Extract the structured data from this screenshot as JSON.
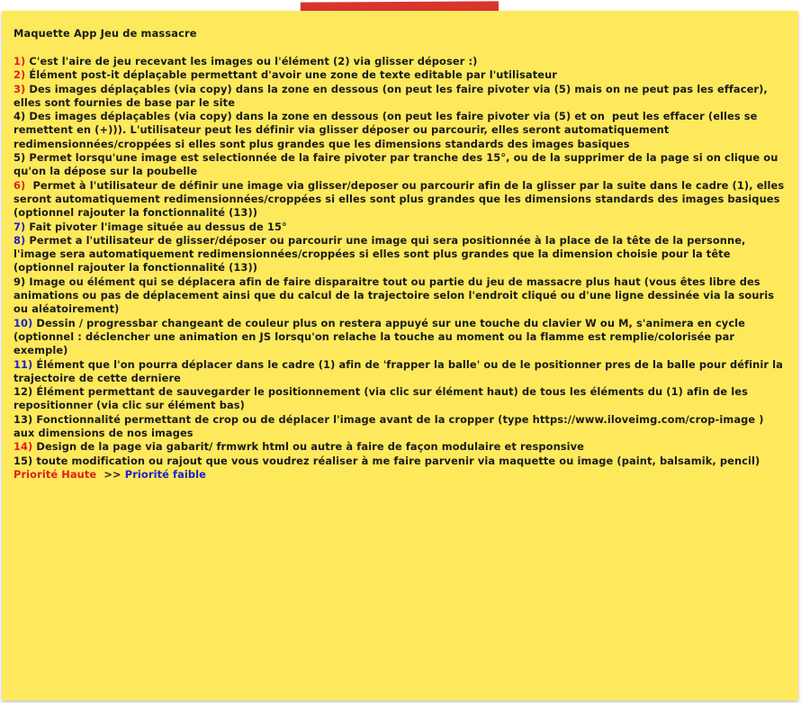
{
  "title": "Maquette App Jeu de massacre",
  "colors": {
    "note_bg": "#fde95b",
    "tape": "#d9342e",
    "high": "#e0201a",
    "low": "#2020d0",
    "mid": "#1a1a1a"
  },
  "items": [
    {
      "num": "1)",
      "color": "#e0201a",
      "text": " C'est l'aire de jeu recevant les images ou l'élément (2) via glisser déposer :)"
    },
    {
      "num": "2)",
      "color": "#e0201a",
      "text": " Élément post-it déplaçable permettant d'avoir une zone de texte editable par l'utilisateur"
    },
    {
      "num": "3)",
      "color": "#e0201a",
      "text": " Des images déplaçables (via copy) dans la zone en dessous (on peut les faire pivoter via (5) mais on ne peut pas les effacer), elles sont fournies de base par le site"
    },
    {
      "num": "4)",
      "color": "#1a1a1a",
      "text": " Des images déplaçables (via copy) dans la zone en dessous (on peut les faire pivoter via (5) et on  peut les effacer (elles se remettent en (+))). L'utilisateur peut les définir via glisser déposer ou parcourir, elles seront automatiquement redimensionnées/croppées si elles sont plus grandes que les dimensions standards des images basiques"
    },
    {
      "num": "5)",
      "color": "#1a1a1a",
      "text": " Permet lorsqu'une image est selectionnée de la faire pivoter par tranche des 15°, ou de la supprimer de la page si on clique ou qu'on la dépose sur la poubelle"
    },
    {
      "num": "6)",
      "color": "#e0201a",
      "text": "  Permet à l'utilisateur de définir une image via glisser/deposer ou parcourir afin de la glisser par la suite dans le cadre (1), elles seront automatiquement redimensionnées/croppées si elles sont plus grandes que les dimensions standards des images basiques (optionnel rajouter la fonctionnalité (13))"
    },
    {
      "num": "7)",
      "color": "#2020d0",
      "text": " Fait pivoter l'image située au dessus de 15°"
    },
    {
      "num": "8)",
      "color": "#2020d0",
      "text": " Permet a l'utilisateur de glisser/déposer ou parcourir une image qui sera positionnée à la place de la tête de la personne, l'image sera automatiquement redimensionnées/croppées si elles sont plus grandes que la dimension choisie pour la tête (optionnel rajouter la fonctionnalité (13))"
    },
    {
      "num": "9)",
      "color": "#1a1a1a",
      "text": " Image ou élément qui se déplacera afin de faire disparaitre tout ou partie du jeu de massacre plus haut (vous êtes libre des animations ou pas de déplacement ainsi que du calcul de la trajectoire selon l'endroit cliqué ou d'une ligne dessinée via la souris ou aléatoirement)"
    },
    {
      "num": "10)",
      "color": "#2020d0",
      "text": " Dessin / progressbar changeant de couleur plus on restera appuyé sur une touche du clavier W ou M, s'animera en cycle (optionnel : déclencher une animation en JS lorsqu'on relache la touche au moment ou la flamme est remplie/colorisée par exemple)"
    },
    {
      "num": "11)",
      "color": "#2020d0",
      "text": " Élément que l'on pourra déplacer dans le cadre (1) afin de 'frapper la balle' ou de le positionner pres de la balle pour définir la trajectoire de cette derniere"
    },
    {
      "num": "12)",
      "color": "#1a1a1a",
      "text": " Élément permettant de sauvegarder le positionnement (via clic sur élément haut) de tous les éléments du (1) afin de les repositionner (via clic sur élément bas)"
    },
    {
      "num": "13)",
      "color": "#1a1a1a",
      "text": " Fonctionnalité permettant de crop ou de déplacer l'image avant de la cropper (type https://www.iloveimg.com/crop-image ) aux dimensions de nos images"
    },
    {
      "num": "14)",
      "color": "#e0201a",
      "text": " Design de la page via gabarit/ frmwrk html ou autre à faire de façon modulaire et responsive"
    },
    {
      "num": "15)",
      "color": "#1a1a1a",
      "text": " toute modification ou rajout que vous voudrez réaliser à me faire parvenir via maquette ou image (paint, balsamik, pencil)"
    }
  ],
  "priority": {
    "high": "Priorité Haute",
    "arrow": "  >> ",
    "low": "Priorité faible"
  }
}
